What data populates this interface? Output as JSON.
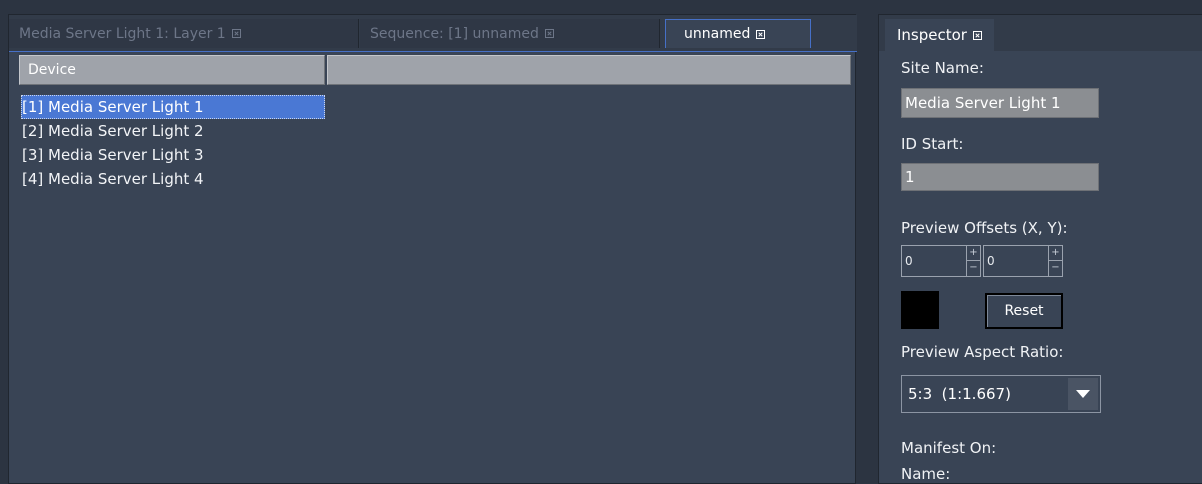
{
  "tabs": [
    {
      "label": "Media Server Light 1: Layer 1"
    },
    {
      "label": "Sequence: [1] unnamed"
    },
    {
      "label": "unnamed"
    }
  ],
  "table": {
    "columns": [
      "Device",
      ""
    ],
    "rows": [
      "[1] Media Server Light 1",
      "[2] Media Server Light 2",
      "[3] Media Server Light 3",
      "[4] Media Server Light 4"
    ],
    "selected_index": 0
  },
  "inspector": {
    "tab_label": "Inspector",
    "site_name_label": "Site Name:",
    "site_name_value": "Media Server Light 1",
    "id_start_label": "ID Start:",
    "id_start_value": "1",
    "preview_offsets_label": "Preview Offsets (X, Y):",
    "offset_x": "0",
    "offset_y": "0",
    "reset_label": "Reset",
    "aspect_label": "Preview Aspect Ratio:",
    "aspect_value": "5:3  (1:1.667)",
    "manifest_label": "Manifest On:",
    "name_label": "Name:",
    "swatch_color": "#000000"
  },
  "colors": {
    "background": "#2c3441",
    "panel": "#394455",
    "selection": "#4a78d4",
    "header": "#9fa3aa",
    "field": "#8b8e92"
  }
}
